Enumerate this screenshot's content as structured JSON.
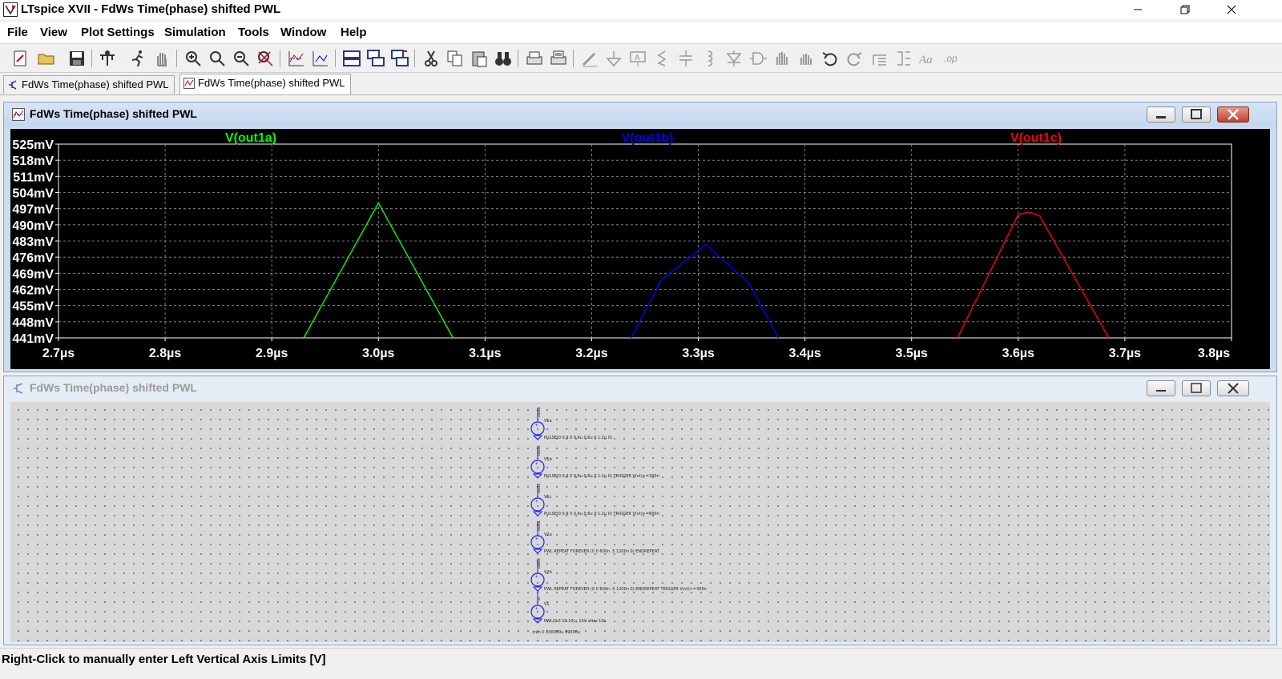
{
  "window": {
    "title": "LTspice XVII - FdWs Time(phase) shifted PWL",
    "controls": [
      "minimize",
      "maximize",
      "close"
    ]
  },
  "menu": [
    "File",
    "View",
    "Plot Settings",
    "Simulation",
    "Tools",
    "Window",
    "Help"
  ],
  "toolbar": {
    "buttons": [
      "new-schematic",
      "open",
      "save",
      "control-panel",
      "run",
      "halt",
      "zoom-in",
      "zoom-area",
      "zoom-out",
      "zoom-fit",
      "autorange",
      "edit-plot-defs",
      "tile-horizontal",
      "cascade",
      "tile-vertical",
      "cut",
      "copy",
      "paste",
      "find",
      "print",
      "print-setup",
      "draw-wire",
      "ground",
      "label-net",
      "resistor",
      "capacitor",
      "inductor",
      "diode",
      "component",
      "move",
      "drag",
      "undo",
      "redo",
      "rotate",
      "mirror",
      "text",
      "spice-directive"
    ]
  },
  "tabs": [
    {
      "label": "FdWs Time(phase) shifted PWL",
      "kind": "schematic",
      "active": false
    },
    {
      "label": "FdWs Time(phase) shifted PWL",
      "kind": "waveform",
      "active": true
    }
  ],
  "plot_window": {
    "title": "FdWs Time(phase) shifted PWL",
    "traces": [
      {
        "name": "V(out1a)",
        "color": "#00ff00"
      },
      {
        "name": "V(out1b)",
        "color": "#0000ff"
      },
      {
        "name": "V(out1c)",
        "color": "#ff0000"
      }
    ]
  },
  "chart_data": {
    "type": "line",
    "title": "",
    "xlabel": "",
    "ylabel": "",
    "x_ticks": [
      "2.7µs",
      "2.8µs",
      "2.9µs",
      "3.0µs",
      "3.1µs",
      "3.2µs",
      "3.3µs",
      "3.4µs",
      "3.5µs",
      "3.6µs",
      "3.7µs",
      "3.8µs"
    ],
    "y_ticks": [
      "525mV",
      "518mV",
      "511mV",
      "504mV",
      "497mV",
      "490mV",
      "483mV",
      "476mV",
      "469mV",
      "462mV",
      "455mV",
      "448mV",
      "441mV"
    ],
    "xlim": [
      2.7,
      3.8
    ],
    "ylim": [
      441,
      525
    ],
    "grid": true,
    "legend_position": "top",
    "series": [
      {
        "name": "V(out1a)",
        "color": "#00ff00",
        "x": [
          2.93,
          3.0,
          3.07
        ],
        "y": [
          441,
          499.5,
          441
        ]
      },
      {
        "name": "V(out1b)",
        "color": "#0000ff",
        "x": [
          3.237,
          3.265,
          3.307,
          3.347,
          3.375
        ],
        "y": [
          441,
          466,
          481.5,
          465,
          441
        ]
      },
      {
        "name": "V(out1c)",
        "color": "#ff0000",
        "x": [
          3.543,
          3.6,
          3.61,
          3.62,
          3.685
        ],
        "y": [
          441,
          494.5,
          495.5,
          494,
          441
        ]
      }
    ]
  },
  "schematic_window": {
    "title": "FdWs Time(phase) shifted PWL",
    "components": [
      {
        "name": "V1a",
        "net": "out1a",
        "value": "PULSE(0 0.9 0 0.6u 0.6u 0 1.2u 0)"
      },
      {
        "name": "V1b",
        "net": "out1b",
        "value": "PULSE(0 0.9 0 0.6u 0.6u 0 1.2u 0) TRIGGER V(vt)>=300n"
      },
      {
        "name": "V1c",
        "net": "out1c",
        "value": "PULSE(0 0.9 0 0.6u 0.6u 0 1.2u 0) TRIGGER V(vt)>=600n"
      },
      {
        "name": "V2a",
        "net": "out2a",
        "value": "PWL REPEAT FOREVER (0 0 600n .5 1200n 0) ENDREPEAT"
      },
      {
        "name": "V2b",
        "net": "out2b",
        "value": "PWL REPEAT FOREVER (0 0 600n .5 1200n 0) ENDREPEAT TRIGGER V(vt)>=300n"
      },
      {
        "name": "V1",
        "net": "vt",
        "value": "PWL(0 0 10 10) ; 10V after 10s"
      }
    ],
    "directive": ".tran 0 100000u 99000u"
  },
  "status": {
    "text": "Right-Click to manually enter Left Vertical Axis Limits [V]"
  }
}
